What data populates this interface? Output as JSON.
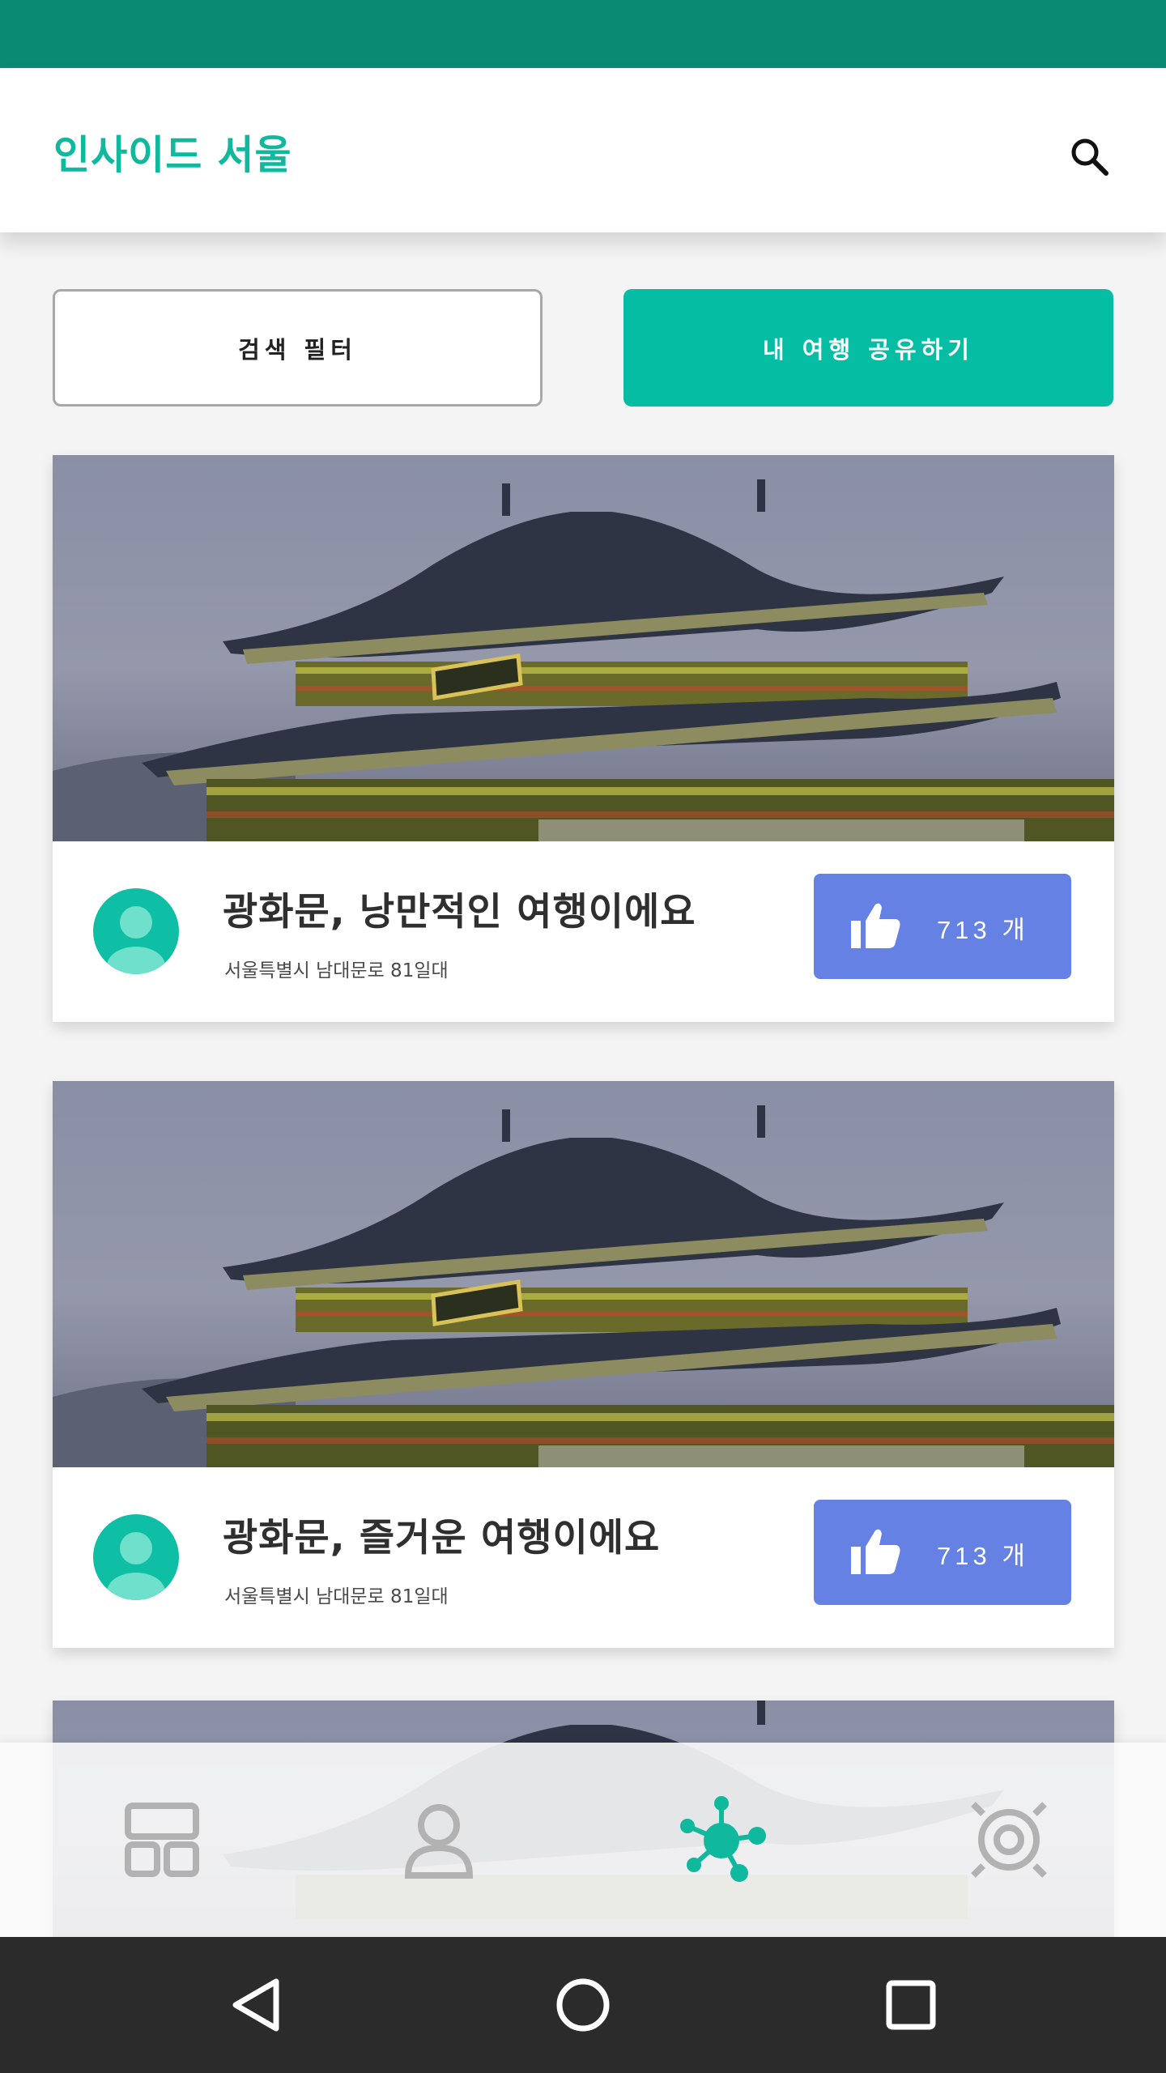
{
  "app": {
    "title": "인사이드 서울"
  },
  "actions": {
    "filter_label": "검색 필터",
    "share_label": "내 여행 공유하기"
  },
  "posts": [
    {
      "title": "광화문, 낭만적인 여행이에요",
      "address": "서울특별시 남대문로 81일대",
      "likes": "713 개"
    },
    {
      "title": "광화문, 즐거운 여행이에요",
      "address": "서울특별시 남대문로 81일대",
      "likes": "713 개"
    }
  ],
  "tabs": [
    {
      "icon": "dashboard-icon",
      "active": false
    },
    {
      "icon": "person-icon",
      "active": false
    },
    {
      "icon": "network-icon",
      "active": true
    },
    {
      "icon": "target-icon",
      "active": false
    }
  ],
  "system_nav": {
    "back": "back-triangle-icon",
    "home": "home-circle-icon",
    "recents": "recents-square-icon"
  },
  "colors": {
    "status_bar": "#0b8a73",
    "accent": "#05bda2",
    "title_accent": "#10b89e",
    "like_button": "#6681e4",
    "tab_inactive": "#b2b2b2",
    "tab_active": "#10b89e",
    "nav_bar": "#2b2b2b"
  }
}
